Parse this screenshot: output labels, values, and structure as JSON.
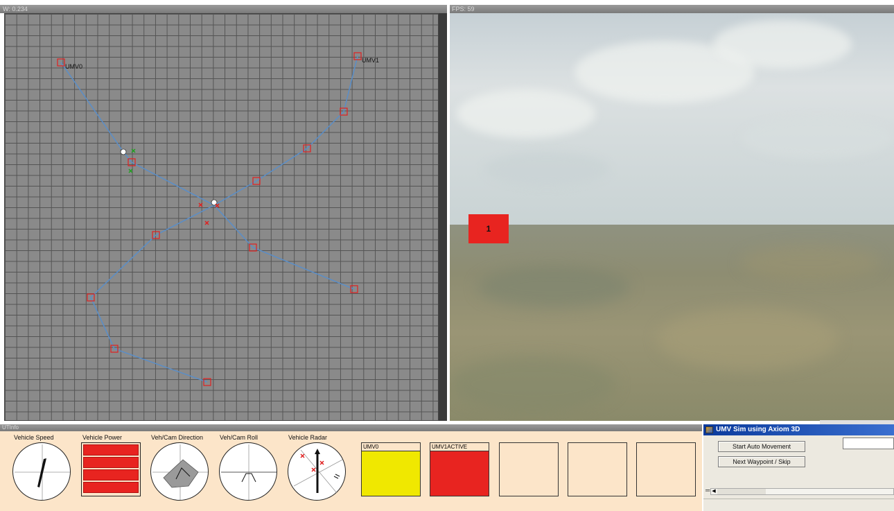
{
  "map_panel": {
    "title": "W: 0.234",
    "vehicle_labels": [
      "UMV0",
      "UMV1"
    ]
  },
  "view_panel": {
    "title": "FPS: 59",
    "waypoint_marker": "1"
  },
  "bottom_panel": {
    "title": "UTInfo",
    "gauges": {
      "speed_label": "Vehicle Speed",
      "power_label": "Vehicle Power",
      "direction_label": "Veh/Cam Direction",
      "roll_label": "Veh/Cam Roll",
      "radar_label": "Vehicle Radar"
    },
    "power_level": 4,
    "vehicle_slots": [
      {
        "label": "UMV0",
        "color": "#f0e800"
      },
      {
        "label": "UMV1ACTIVE",
        "color": "#e82420"
      },
      {
        "label": "",
        "color": ""
      },
      {
        "label": "",
        "color": ""
      },
      {
        "label": "",
        "color": ""
      }
    ]
  },
  "control_window": {
    "title": "UMV Sim using Axiom 3D",
    "start_button": "Start Auto Movement",
    "next_button": "Next Waypoint / Skip",
    "text_field_value": ""
  },
  "colors": {
    "path_line": "#5a8ec8",
    "waypoint": "#e02020",
    "active": "#e82420",
    "standby": "#f0e800"
  }
}
